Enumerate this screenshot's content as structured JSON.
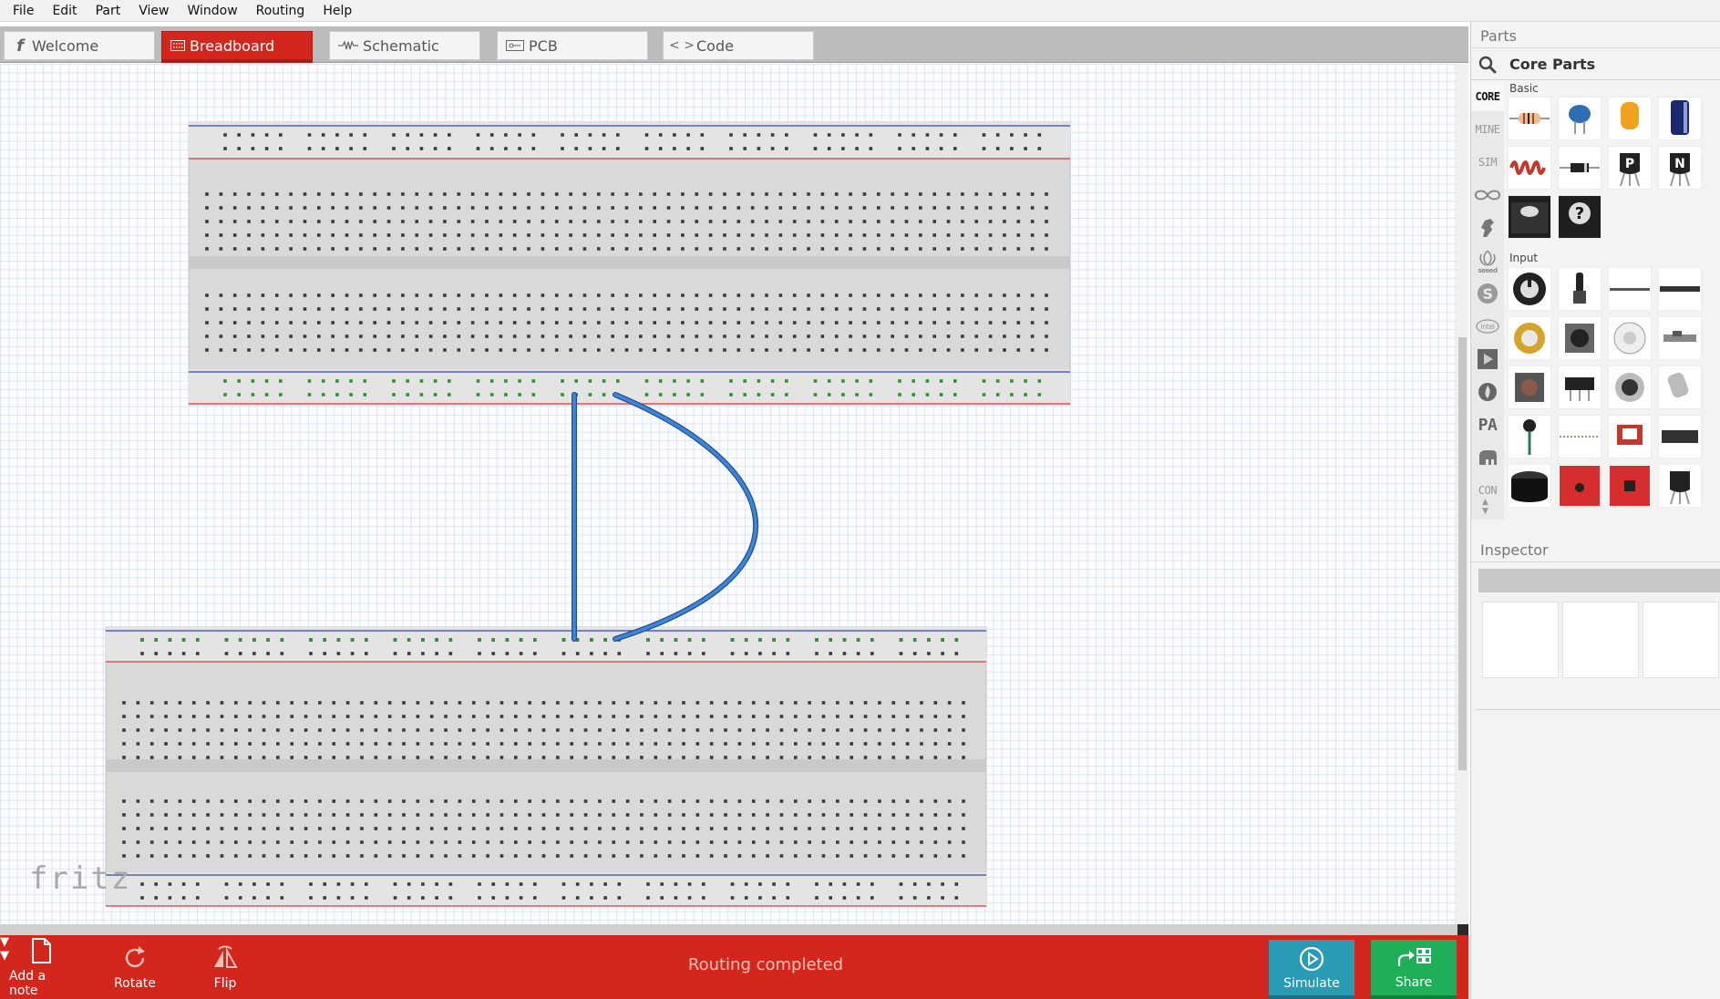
{
  "menubar": {
    "items": [
      {
        "label": "File"
      },
      {
        "label": "Edit"
      },
      {
        "label": "Part"
      },
      {
        "label": "View"
      },
      {
        "label": "Window"
      },
      {
        "label": "Routing"
      },
      {
        "label": "Help"
      }
    ]
  },
  "tabs": [
    {
      "label": "Welcome",
      "icon": "fritzing-f-icon",
      "active": false
    },
    {
      "label": "Breadboard",
      "icon": "breadboard-icon",
      "active": true
    },
    {
      "label": "Schematic",
      "icon": "resistor-wave-icon",
      "active": false
    },
    {
      "label": "PCB",
      "icon": "pcb-icon",
      "active": false
    },
    {
      "label": "Code",
      "icon": "code-brackets-icon",
      "active": false
    }
  ],
  "canvas": {
    "logo": "fritz",
    "wire_color": "#2f6fc1"
  },
  "toolbar": {
    "add_note": "Add a note",
    "rotate": "Rotate",
    "flip": "Flip",
    "status": "Routing completed",
    "simulate": "Simulate",
    "share": "Share",
    "accent": "#d3271d",
    "simulate_color": "#2a9bb4",
    "share_color": "#1eaf58"
  },
  "parts": {
    "title": "Parts",
    "bin_title": "Core Parts",
    "bin_tabs": [
      "CORE",
      "MINE",
      "SIM",
      "arduino-icon",
      "fist-icon",
      "seeed",
      "sparkfun-s-icon",
      "intel",
      "play-icon",
      "flame-icon",
      "PA",
      "elephant-icon",
      "CON"
    ],
    "groups": [
      {
        "label": "Basic",
        "items": [
          "resistor",
          "ceramic-capacitor",
          "tantalum-capacitor",
          "electrolytic-capacitor",
          "inductor",
          "diode",
          "pnp-transistor",
          "npn-transistor",
          "fet",
          "mystery-part"
        ]
      },
      {
        "label": "Input",
        "items": [
          "potentiometer",
          "slide-potentiometer",
          "flex-sensor",
          "fsr",
          "piezo",
          "rotary-encoder",
          "dip-switch",
          "slide-switch",
          "pushbutton",
          "toggle-switch",
          "joystick",
          "tilt-sensor",
          "microphone",
          "stretch-sensor",
          "keyboard-matrix",
          "ultrasonic-sensor",
          "buzzer",
          "sparkfun-board-a",
          "sparkfun-board-b",
          "temperature-sensor"
        ]
      }
    ]
  },
  "inspector": {
    "title": "Inspector"
  }
}
